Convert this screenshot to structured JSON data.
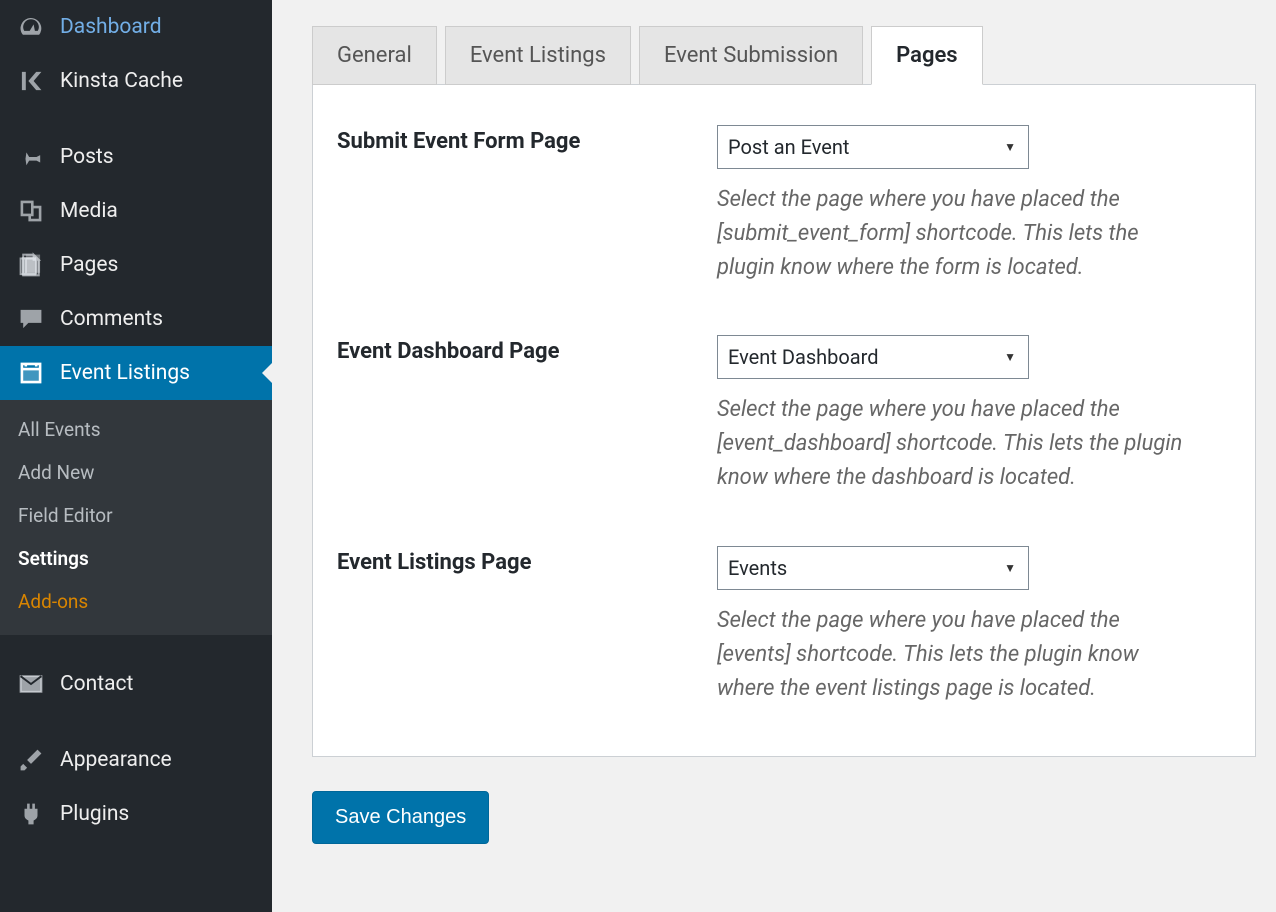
{
  "sidebar": {
    "items": [
      {
        "label": "Dashboard",
        "icon": "dashboard"
      },
      {
        "label": "Kinsta Cache",
        "icon": "kinsta"
      },
      {
        "label": "Posts",
        "icon": "pin"
      },
      {
        "label": "Media",
        "icon": "media"
      },
      {
        "label": "Pages",
        "icon": "pages"
      },
      {
        "label": "Comments",
        "icon": "comment"
      },
      {
        "label": "Event Listings",
        "icon": "calendar"
      },
      {
        "label": "Contact",
        "icon": "mail"
      },
      {
        "label": "Appearance",
        "icon": "brush"
      },
      {
        "label": "Plugins",
        "icon": "plug"
      }
    ],
    "submenu": [
      {
        "label": "All Events"
      },
      {
        "label": "Add New"
      },
      {
        "label": "Field Editor"
      },
      {
        "label": "Settings"
      },
      {
        "label": "Add-ons"
      }
    ]
  },
  "tabs": [
    {
      "label": "General"
    },
    {
      "label": "Event Listings"
    },
    {
      "label": "Event Submission"
    },
    {
      "label": "Pages"
    }
  ],
  "form": {
    "rows": [
      {
        "label": "Submit Event Form Page",
        "value": "Post an Event",
        "desc": "Select the page where you have placed the [submit_event_form] shortcode. This lets the plugin know where the form is located."
      },
      {
        "label": "Event Dashboard Page",
        "value": "Event Dashboard",
        "desc": "Select the page where you have placed the [event_dashboard] shortcode. This lets the plugin know where the dashboard is located."
      },
      {
        "label": "Event Listings Page",
        "value": "Events",
        "desc": "Select the page where you have placed the [events] shortcode. This lets the plugin know where the event listings page is located."
      }
    ],
    "save": "Save Changes"
  }
}
